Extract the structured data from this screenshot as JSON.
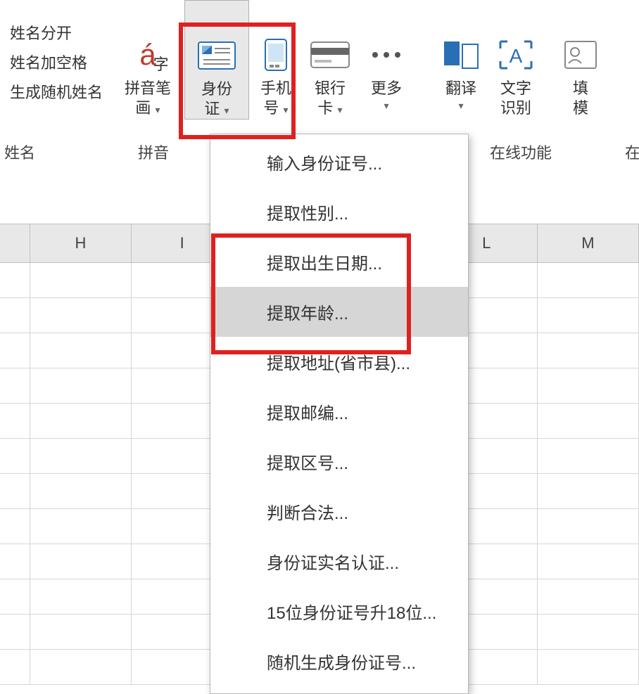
{
  "ribbon": {
    "name_group": {
      "items": [
        "姓名分开",
        "姓名加空格",
        "生成随机姓名"
      ],
      "label": "姓名"
    },
    "pinyin_group": {
      "btn_label_line1": "拼音笔",
      "btn_label_line2": "画",
      "label": "拼音"
    },
    "id_btn": {
      "line1": "身份",
      "line2": "证"
    },
    "phone_btn": {
      "line1": "手机",
      "line2": "号"
    },
    "bank_btn": {
      "line1": "银行",
      "line2": "卡"
    },
    "more_btn": {
      "label": "更多"
    },
    "translate_btn": {
      "label": "翻译"
    },
    "ocr_btn": {
      "line1": "文字",
      "line2": "识别"
    },
    "online_label": "在线功能",
    "fill_btn": {
      "line1": "填",
      "line2": "模"
    },
    "fill_label_prefix": "在"
  },
  "columns": [
    "H",
    "I",
    "L",
    "M"
  ],
  "menu": {
    "items": [
      "输入身份证号...",
      "提取性别...",
      "提取出生日期...",
      "提取年龄...",
      "提取地址(省市县)...",
      "提取邮编...",
      "提取区号...",
      "判断合法...",
      "身份证实名认证...",
      "15位身份证号升18位...",
      "随机生成身份证号..."
    ],
    "hover_index": 3
  }
}
